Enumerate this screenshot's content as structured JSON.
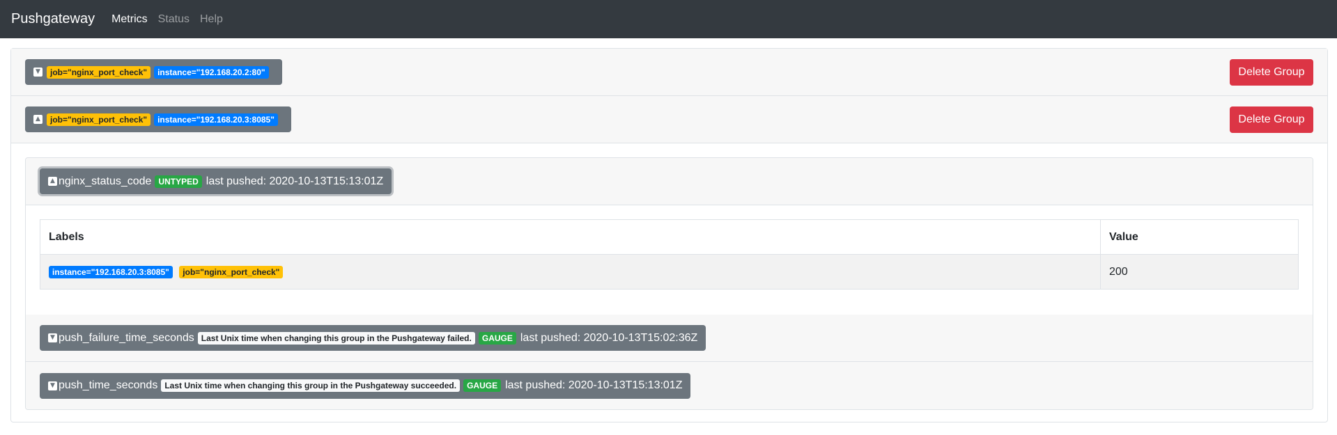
{
  "navbar": {
    "brand": "Pushgateway",
    "links": [
      {
        "label": "Metrics",
        "active": true
      },
      {
        "label": "Status",
        "active": false
      },
      {
        "label": "Help",
        "active": false
      }
    ]
  },
  "groups": [
    {
      "labels": [
        "job=\"nginx_port_check\"",
        "instance=\"192.168.20.2:80\""
      ],
      "delete_label": "Delete Group",
      "expanded": false
    },
    {
      "labels": [
        "job=\"nginx_port_check\"",
        "instance=\"192.168.20.3:8085\""
      ],
      "delete_label": "Delete Group",
      "expanded": true,
      "metrics": [
        {
          "name": "nginx_status_code",
          "type": "UNTYPED",
          "help": "",
          "last_pushed": "last pushed: 2020-10-13T15:13:01Z",
          "expanded": true,
          "table": {
            "headers": [
              "Labels",
              "Value"
            ],
            "rows": [
              {
                "labels": [
                  "instance=\"192.168.20.3:8085\"",
                  "job=\"nginx_port_check\""
                ],
                "value": "200"
              }
            ]
          }
        },
        {
          "name": "push_failure_time_seconds",
          "type": "GAUGE",
          "help": "Last Unix time when changing this group in the Pushgateway failed.",
          "last_pushed": "last pushed: 2020-10-13T15:02:36Z",
          "expanded": false
        },
        {
          "name": "push_time_seconds",
          "type": "GAUGE",
          "help": "Last Unix time when changing this group in the Pushgateway succeeded.",
          "last_pushed": "last pushed: 2020-10-13T15:13:01Z",
          "expanded": false
        }
      ]
    }
  ],
  "colors": {
    "navbar": "#343a40",
    "secondary": "#6c757d",
    "danger": "#dc3545",
    "warning": "#ffc107",
    "primary": "#007bff",
    "success": "#28a745"
  },
  "icons": {
    "collapsed": "chevron-down-icon",
    "expanded": "chevron-up-icon"
  }
}
